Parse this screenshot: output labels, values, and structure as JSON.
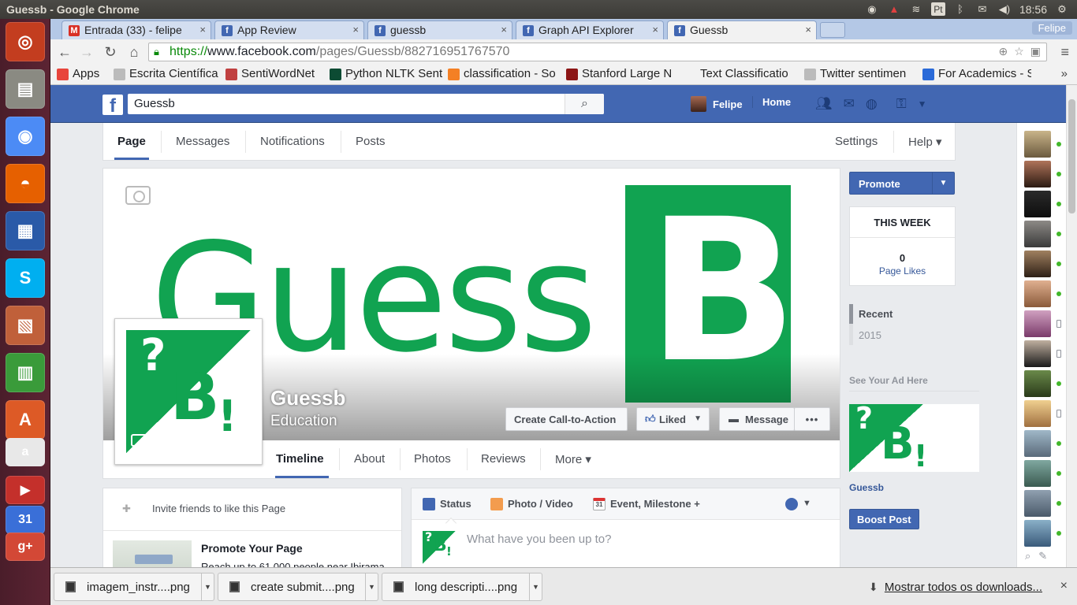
{
  "os": {
    "window_title": "Guessb - Google Chrome",
    "clock": "18:56",
    "keyboard_layout": "Pt",
    "launcher": [
      {
        "name": "ubuntu-dash-icon",
        "color": "#c33d1f",
        "glyph": "◎"
      },
      {
        "name": "files-icon",
        "color": "#8a8a82",
        "glyph": "▤"
      },
      {
        "name": "chrome-icon",
        "color": "#4c8bf5",
        "glyph": "◉"
      },
      {
        "name": "firefox-icon",
        "color": "#e66000",
        "glyph": "◓"
      },
      {
        "name": "writer-icon",
        "color": "#2a5aa8",
        "glyph": "▦"
      },
      {
        "name": "skype-icon",
        "color": "#00aff0",
        "glyph": "S"
      },
      {
        "name": "impress-icon",
        "color": "#c0603a",
        "glyph": "▧"
      },
      {
        "name": "calc-icon",
        "color": "#3a9b3a",
        "glyph": "▥"
      },
      {
        "name": "software-center-icon",
        "color": "#dd5a26",
        "glyph": "A"
      },
      {
        "name": "amazon-icon",
        "color": "#e8e8e8",
        "glyph": "a"
      },
      {
        "name": "youtube-icon",
        "color": "#c4302b",
        "glyph": "▶"
      },
      {
        "name": "calendar-icon",
        "color": "#3a6fd8",
        "glyph": "31"
      },
      {
        "name": "google-plus-icon",
        "color": "#d34836",
        "glyph": "g+"
      }
    ]
  },
  "browser": {
    "tabs": [
      {
        "title": "Entrada (33) - felipe",
        "icon": "gmail-icon",
        "icon_color": "#d93025",
        "icon_glyph": "M"
      },
      {
        "title": "App Review",
        "icon": "facebook-icon",
        "icon_color": "#4267b2",
        "icon_glyph": "f"
      },
      {
        "title": "guessb",
        "icon": "facebook-icon",
        "icon_color": "#4267b2",
        "icon_glyph": "f"
      },
      {
        "title": "Graph API Explorer",
        "icon": "facebook-icon",
        "icon_color": "#4267b2",
        "icon_glyph": "f"
      },
      {
        "title": "Guessb",
        "icon": "facebook-icon",
        "icon_color": "#4267b2",
        "icon_glyph": "f"
      }
    ],
    "profile_name": "Felipe",
    "url_secure": "https://",
    "url_host": "www.facebook.com",
    "url_path": "/pages/Guessb/882716951767570",
    "bookmarks": [
      {
        "label": "Apps",
        "icon": "apps-grid-icon",
        "color": "#e8453c"
      },
      {
        "label": "Escrita Científica",
        "icon": "page-icon",
        "color": "#bbbbbb"
      },
      {
        "label": "SentiWordNet",
        "icon": "sentiwordnet-icon",
        "color": "#c04040"
      },
      {
        "label": "Python NLTK Sent",
        "icon": "django-icon",
        "color": "#0c4b33"
      },
      {
        "label": "classification - So",
        "icon": "stackoverflow-icon",
        "color": "#f48024"
      },
      {
        "label": "Stanford Large N",
        "icon": "stanford-icon",
        "color": "#8c1515"
      },
      {
        "label": "Text Classificatio",
        "icon": "blank-icon",
        "color": "#f2f2f2"
      },
      {
        "label": "Twitter sentimen",
        "icon": "page-icon",
        "color": "#bbbbbb"
      },
      {
        "label": "For Academics - S",
        "icon": "academics-icon",
        "color": "#2a6ad8"
      }
    ],
    "bookmarks_overflow": "»"
  },
  "facebook": {
    "search_value": "Guessb",
    "user_name": "Felipe",
    "home_label": "Home",
    "page_nav": {
      "tabs": [
        "Page",
        "Messages",
        "Notifications",
        "Posts"
      ],
      "settings": "Settings",
      "help": "Help ▾"
    },
    "page": {
      "name": "Guessb",
      "category": "Education",
      "cover_word": "Guess",
      "cover_letter": "B",
      "logo_q": "?",
      "logo_b": "B",
      "logo_ex": "!",
      "buttons": {
        "cta": "Create Call-to-Action",
        "liked": "Liked",
        "message": "Message",
        "more": "•••"
      },
      "timeline_tabs": [
        "Timeline",
        "About",
        "Photos",
        "Reviews",
        "More ▾"
      ]
    },
    "left_card": {
      "invite": "Invite friends to like this Page",
      "promote_title": "Promote Your Page",
      "promote_desc": "Reach up to 61,000 people near Ibirama"
    },
    "composer": {
      "tabs": [
        "Status",
        "Photo / Video",
        "Event, Milestone +"
      ],
      "placeholder": "What have you been up to?"
    },
    "right_col": {
      "promote": "Promote",
      "this_week": "THIS WEEK",
      "page_likes_count": "0",
      "page_likes_label": "Page Likes",
      "recent": "Recent",
      "year": "2015",
      "see_ad": "See Your Ad Here",
      "ad_page_name": "Guessb",
      "boost": "Boost Post"
    },
    "chat_contacts": [
      {
        "colors": [
          "#c9b48a",
          "#6b5a3e"
        ],
        "status": "online"
      },
      {
        "colors": [
          "#b0745a",
          "#2b1a12"
        ],
        "status": "online"
      },
      {
        "colors": [
          "#2a2a2a",
          "#0e0e0e"
        ],
        "status": "online"
      },
      {
        "colors": [
          "#8d8a86",
          "#3a3a3a"
        ],
        "status": "online"
      },
      {
        "colors": [
          "#a08060",
          "#2e2016"
        ],
        "status": "online"
      },
      {
        "colors": [
          "#e0b090",
          "#8a5a3a"
        ],
        "status": "online"
      },
      {
        "colors": [
          "#d0a0c0",
          "#7a3a6a"
        ],
        "status": "mobile"
      },
      {
        "colors": [
          "#c0b0a0",
          "#1a1a1a"
        ],
        "status": "mobile"
      },
      {
        "colors": [
          "#6a8a4a",
          "#2a3a1a"
        ],
        "status": "online"
      },
      {
        "colors": [
          "#f0d090",
          "#a07040"
        ],
        "status": "mobile"
      },
      {
        "colors": [
          "#a0b8c8",
          "#5a6a7a"
        ],
        "status": "online"
      },
      {
        "colors": [
          "#80a8a0",
          "#3a5a50"
        ],
        "status": "online"
      },
      {
        "colors": [
          "#90a0b0",
          "#4a5a6a"
        ],
        "status": "online"
      },
      {
        "colors": [
          "#8ab0c8",
          "#3a5a7a"
        ],
        "status": "online"
      }
    ]
  },
  "downloads": {
    "items": [
      "imagem_instr....png",
      "create submit....png",
      "long descripti....png"
    ],
    "show_all": "Mostrar todos os downloads...",
    "close": "×"
  }
}
